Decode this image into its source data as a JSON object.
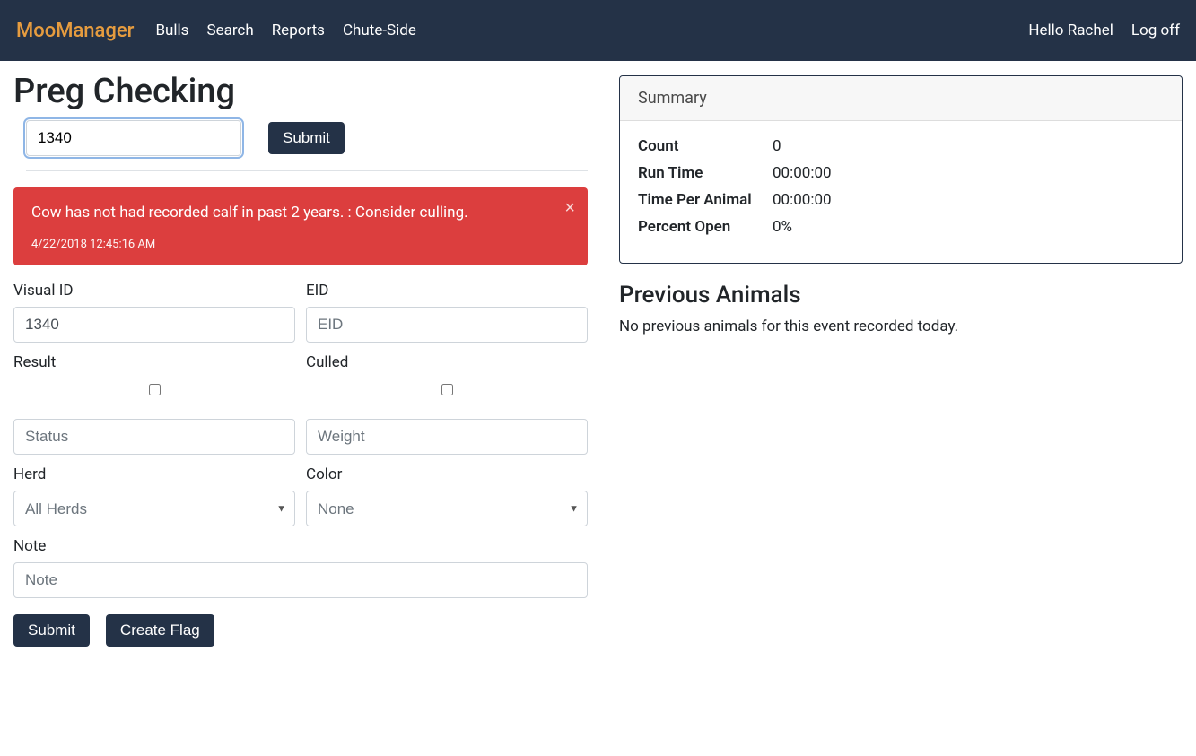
{
  "nav": {
    "brand": "MooManager",
    "items": [
      "Bulls",
      "Search",
      "Reports",
      "Chute-Side"
    ],
    "user_greeting": "Hello Rachel",
    "logoff": "Log off"
  },
  "page": {
    "title": "Preg Checking",
    "search_value": "1340",
    "submit_label": "Submit"
  },
  "alert": {
    "message": "Cow has not had recorded calf in past 2 years. : Consider culling.",
    "timestamp": "4/22/2018 12:45:16 AM"
  },
  "form": {
    "visual_id": {
      "label": "Visual ID",
      "value": "1340"
    },
    "eid": {
      "label": "EID",
      "placeholder": "EID"
    },
    "result": {
      "label": "Result"
    },
    "culled": {
      "label": "Culled"
    },
    "status": {
      "placeholder": "Status"
    },
    "weight": {
      "placeholder": "Weight"
    },
    "herd": {
      "label": "Herd",
      "selected": "All Herds"
    },
    "color": {
      "label": "Color",
      "selected": "None"
    },
    "note": {
      "label": "Note",
      "placeholder": "Note"
    },
    "submit_label": "Submit",
    "create_flag_label": "Create Flag"
  },
  "summary": {
    "title": "Summary",
    "rows": [
      {
        "label": "Count",
        "value": "0"
      },
      {
        "label": "Run Time",
        "value": "00:00:00"
      },
      {
        "label": "Time Per Animal",
        "value": "00:00:00"
      },
      {
        "label": "Percent Open",
        "value": "0%"
      }
    ]
  },
  "previous": {
    "title": "Previous Animals",
    "empty_text": "No previous animals for this event recorded today."
  }
}
